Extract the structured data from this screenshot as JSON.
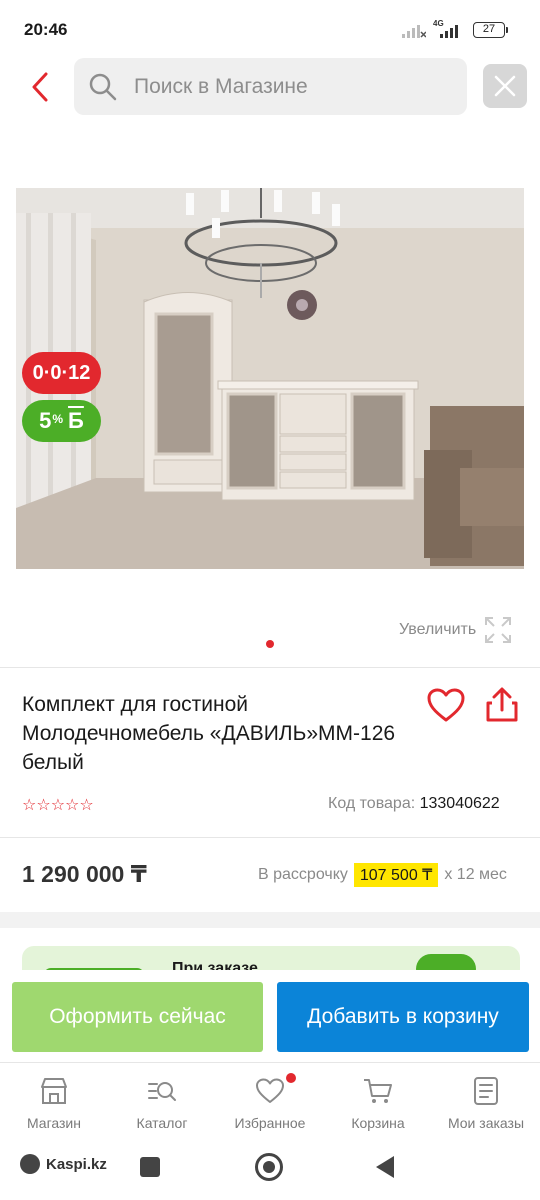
{
  "status_bar": {
    "time": "20:46",
    "network": "4G",
    "battery": "27"
  },
  "header": {
    "search_placeholder": "Поиск в Магазине"
  },
  "product": {
    "badge_installment": "0·0·12",
    "badge_bonus_percent": "5",
    "badge_bonus_unit": "%",
    "badge_bonus_letter": "Б",
    "zoom_label": "Увеличить",
    "title": "Комплект для гостиной Молодечномебель «ДАВИЛЬ»ММ-126 белый",
    "rating_stars": "☆☆☆☆☆",
    "sku_label": "Код товара:",
    "sku_value": "133040622",
    "price": "1 290 000 ₸",
    "installment_prefix": "В рассрочку",
    "installment_amount": "107 500 ₸",
    "installment_suffix": "х 12 мес"
  },
  "promo": {
    "text": "При заказе"
  },
  "actions": {
    "buy_now": "Оформить сейчас",
    "add_to_cart": "Добавить в корзину"
  },
  "tabs": [
    {
      "label": "Магазин"
    },
    {
      "label": "Каталог"
    },
    {
      "label": "Избранное"
    },
    {
      "label": "Корзина"
    },
    {
      "label": "Мои заказы"
    }
  ],
  "system": {
    "brand": "Kaspi.kz"
  },
  "colors": {
    "accent_red": "#e2282e",
    "buy_now_green": "#9fd86f",
    "add_cart_blue": "#0b84d8",
    "bonus_green": "#4cae27",
    "highlight_yellow": "#ffe600"
  }
}
